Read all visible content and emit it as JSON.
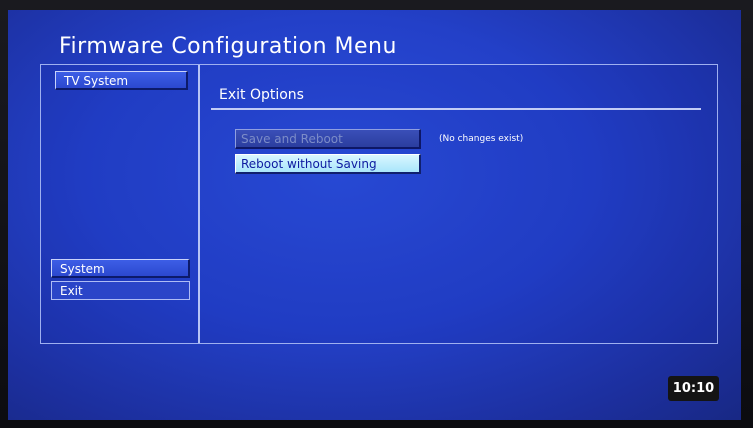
{
  "menu": {
    "title": "Firmware Configuration Menu"
  },
  "sidebar": {
    "items": [
      {
        "label": "TV System"
      },
      {
        "label": "System"
      },
      {
        "label": "Exit"
      }
    ],
    "selected": "Exit"
  },
  "content": {
    "section_title": "Exit Options",
    "buttons": [
      {
        "label": "Save and Reboot",
        "state": "disabled"
      },
      {
        "label": "Reboot without Saving",
        "state": "focused"
      }
    ],
    "note": "(No changes exist)"
  },
  "status": {
    "clock": "10:10"
  },
  "colors": {
    "background": "#2340c8",
    "focused_button": "#bdeefc",
    "text": "#ffffff"
  }
}
